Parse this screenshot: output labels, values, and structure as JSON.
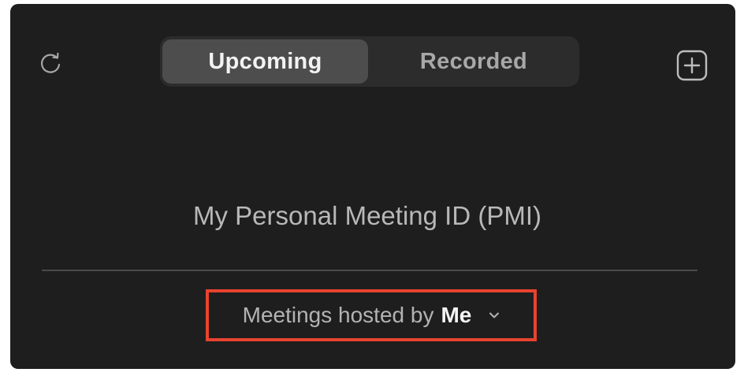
{
  "tabs": {
    "upcoming": "Upcoming",
    "recorded": "Recorded",
    "selected": "Upcoming"
  },
  "icons": {
    "refresh": "refresh-icon",
    "add": "plus-square-icon",
    "dropdown": "chevron-down-icon"
  },
  "main": {
    "pmi_label": "My Personal Meeting ID (PMI)"
  },
  "filter": {
    "prefix": "Meetings hosted by",
    "value": "Me"
  },
  "colors": {
    "background": "#1e1e1e",
    "highlight_border": "#e8432f"
  }
}
